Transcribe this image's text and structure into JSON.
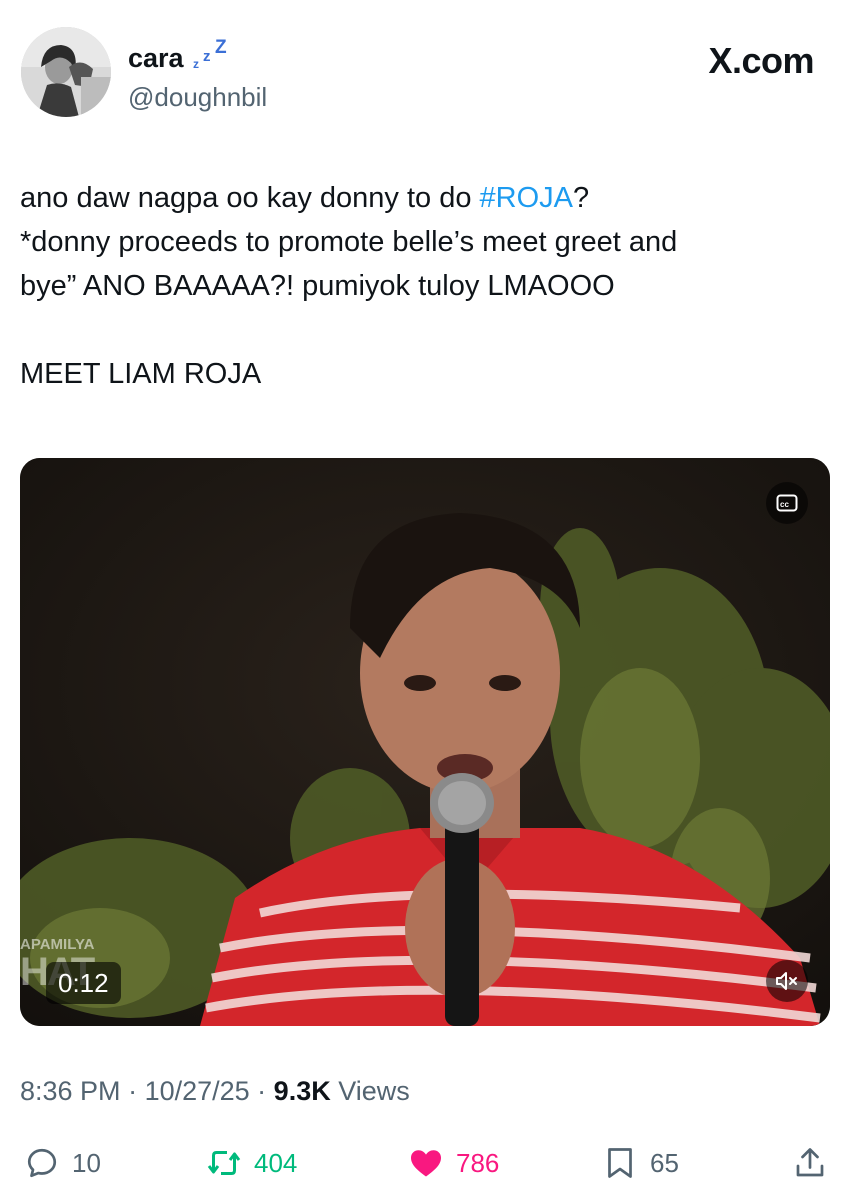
{
  "user": {
    "display_name": "cara",
    "handle": "@doughnbil",
    "avatar_icon": "profile-photo"
  },
  "site": {
    "logo": "X.com"
  },
  "tweet": {
    "line1_before": "ano daw nagpa oo kay donny to do ",
    "hashtag": "#ROJA",
    "line1_after": "?",
    "line2": "*donny proceeds to promote belle’s meet greet and",
    "line3": "bye” ANO BAAAAA?! pumiyok tuloy LMAOOO",
    "line4": "MEET LIAM ROJA"
  },
  "video": {
    "duration": "0:12",
    "cc_icon": "closed-captions-icon",
    "mute_icon": "speaker-muted-icon",
    "watermark_top": "APAMILYA",
    "watermark_bottom": "HAT"
  },
  "meta": {
    "time": "8:36 PM",
    "separator": " · ",
    "date": "10/27/25",
    "views_count": "9.3K",
    "views_label": " Views"
  },
  "actions": {
    "replies": "10",
    "reposts": "404",
    "likes": "786",
    "bookmarks": "65"
  },
  "colors": {
    "accent": "#1d9bf0",
    "repost": "#00ba7c",
    "like": "#f91880",
    "muted_text": "#536471",
    "zzz": "#3b6fd6"
  }
}
